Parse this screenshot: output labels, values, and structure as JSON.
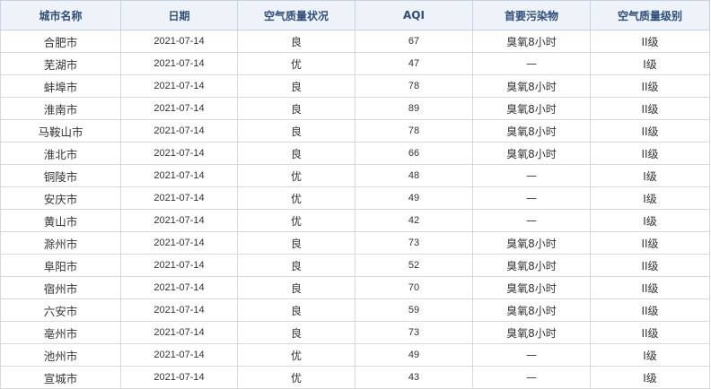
{
  "table": {
    "headers": [
      "城市名称",
      "日期",
      "空气质量状况",
      "AQI",
      "首要污染物",
      "空气质量级别"
    ],
    "rows": [
      {
        "city": "合肥市",
        "date": "2021-07-14",
        "status": "良",
        "aqi": "67",
        "pollutant": "臭氧8小时",
        "level": "II级"
      },
      {
        "city": "芜湖市",
        "date": "2021-07-14",
        "status": "优",
        "aqi": "47",
        "pollutant": "—",
        "level": "I级"
      },
      {
        "city": "蚌埠市",
        "date": "2021-07-14",
        "status": "良",
        "aqi": "78",
        "pollutant": "臭氧8小时",
        "level": "II级"
      },
      {
        "city": "淮南市",
        "date": "2021-07-14",
        "status": "良",
        "aqi": "89",
        "pollutant": "臭氧8小时",
        "level": "II级"
      },
      {
        "city": "马鞍山市",
        "date": "2021-07-14",
        "status": "良",
        "aqi": "78",
        "pollutant": "臭氧8小时",
        "level": "II级"
      },
      {
        "city": "淮北市",
        "date": "2021-07-14",
        "status": "良",
        "aqi": "66",
        "pollutant": "臭氧8小时",
        "level": "II级"
      },
      {
        "city": "铜陵市",
        "date": "2021-07-14",
        "status": "优",
        "aqi": "48",
        "pollutant": "—",
        "level": "I级"
      },
      {
        "city": "安庆市",
        "date": "2021-07-14",
        "status": "优",
        "aqi": "49",
        "pollutant": "—",
        "level": "I级"
      },
      {
        "city": "黄山市",
        "date": "2021-07-14",
        "status": "优",
        "aqi": "42",
        "pollutant": "—",
        "level": "I级"
      },
      {
        "city": "滁州市",
        "date": "2021-07-14",
        "status": "良",
        "aqi": "73",
        "pollutant": "臭氧8小时",
        "level": "II级"
      },
      {
        "city": "阜阳市",
        "date": "2021-07-14",
        "status": "良",
        "aqi": "52",
        "pollutant": "臭氧8小时",
        "level": "II级"
      },
      {
        "city": "宿州市",
        "date": "2021-07-14",
        "status": "良",
        "aqi": "70",
        "pollutant": "臭氧8小时",
        "level": "II级"
      },
      {
        "city": "六安市",
        "date": "2021-07-14",
        "status": "良",
        "aqi": "59",
        "pollutant": "臭氧8小时",
        "level": "II级"
      },
      {
        "city": "亳州市",
        "date": "2021-07-14",
        "status": "良",
        "aqi": "73",
        "pollutant": "臭氧8小时",
        "level": "II级"
      },
      {
        "city": "池州市",
        "date": "2021-07-14",
        "status": "优",
        "aqi": "49",
        "pollutant": "—",
        "level": "I级"
      },
      {
        "city": "宣城市",
        "date": "2021-07-14",
        "status": "优",
        "aqi": "43",
        "pollutant": "—",
        "level": "I级"
      }
    ]
  }
}
